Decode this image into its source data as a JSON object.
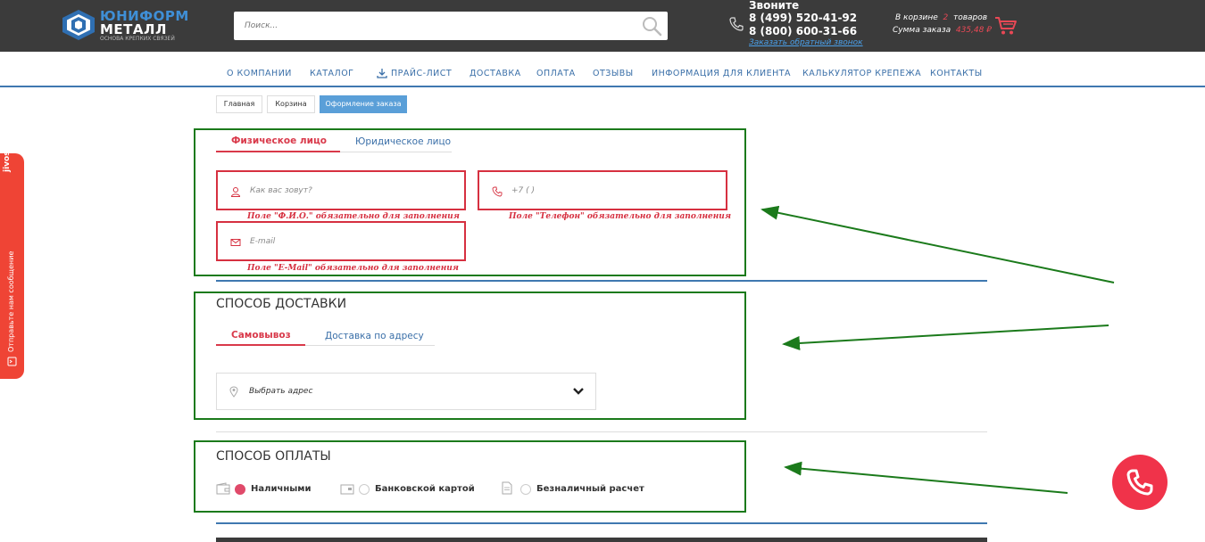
{
  "header": {
    "logo": {
      "line1": "ЮНИФОРМ",
      "line2": "МЕТАЛЛ",
      "tagline": "ОСНОВА КРЕПКИХ СВЯЗЕЙ"
    },
    "search": {
      "placeholder": "Поиск...",
      "icon": "search-icon"
    },
    "contact": {
      "title": "Звоните",
      "phone1": "8 (499) 520-41-92",
      "phone2": "8 (800) 600-31-66",
      "callback": "Заказать обратный звонок"
    },
    "cart": {
      "in_cart_prefix": "В корзине",
      "count": "2",
      "in_cart_suffix": "товаров",
      "sum_label": "Сумма заказа",
      "sum_value": "435,48 ₽"
    }
  },
  "nav": {
    "items": [
      "О КОМПАНИИ",
      "КАТАЛОГ",
      "ПРАЙС-ЛИСТ",
      "ДОСТАВКА",
      "ОПЛАТА",
      "ОТЗЫВЫ",
      "ИНФОРМАЦИЯ ДЛЯ КЛИЕНТА",
      "КАЛЬКУЛЯТОР КРЕПЕЖА",
      "КОНТАКТЫ"
    ]
  },
  "breadcrumbs": [
    "Главная",
    "Корзина",
    "Оформление заказа"
  ],
  "customer": {
    "tabs": [
      "Физическое лицо",
      "Юридическое лицо"
    ],
    "name_placeholder": "Как вас зовут?",
    "phone_placeholder": "+7 (    )",
    "email_placeholder": "E-mail",
    "err_name": "Поле \"Ф.И.О.\" обязательно для заполнения",
    "err_phone": "Поле \"Телефон\" обязательно для заполнения",
    "err_email": "Поле \"E-Mail\" обязательно для заполнения"
  },
  "delivery": {
    "title": "СПОСОБ ДОСТАВКИ",
    "tabs": [
      "Самовывоз",
      "Доставка по адресу"
    ],
    "select_placeholder": "Выбрать адрес"
  },
  "payment": {
    "title": "СПОСОБ ОПЛАТЫ",
    "options": [
      "Наличными",
      "Банковской картой",
      "Безналичный расчет"
    ],
    "selected": "Наличными"
  },
  "widget": {
    "brand": "jivosite",
    "message": "Отправьте нам сообщение"
  },
  "colors": {
    "accent_red": "#d9394a",
    "link_blue": "#3a6fa8",
    "annotation_green": "#1b7a1b",
    "header_bg": "#3b3b3b"
  }
}
